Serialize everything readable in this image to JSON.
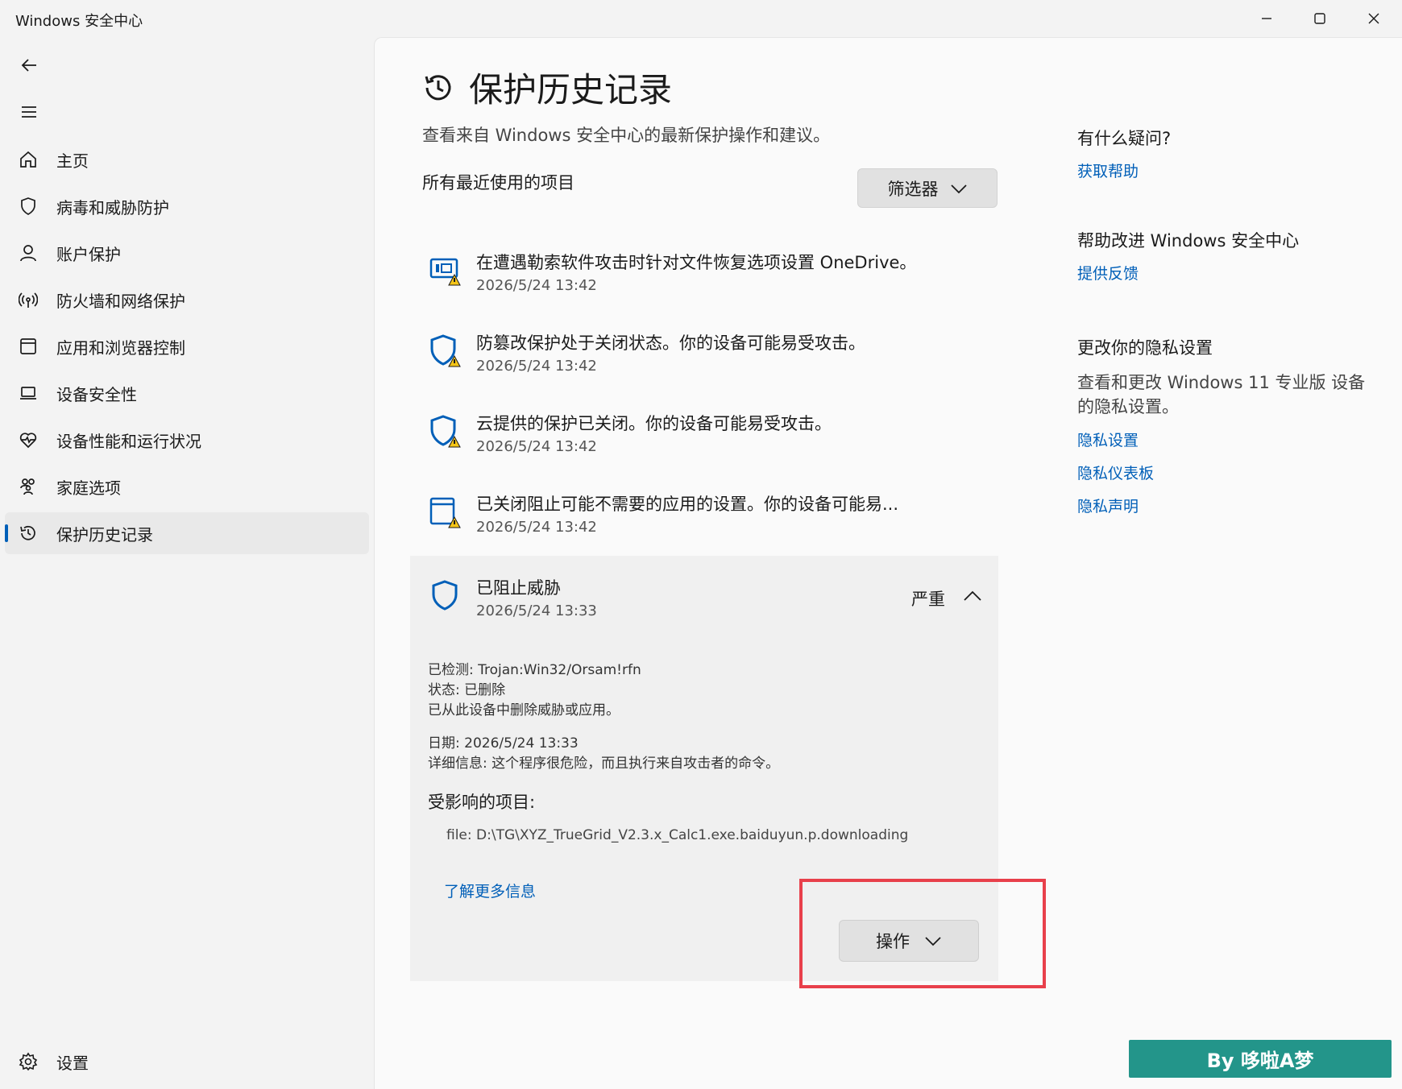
{
  "window": {
    "title": "Windows 安全中心"
  },
  "sidebar": {
    "items": [
      {
        "label": "主页"
      },
      {
        "label": "病毒和威胁防护"
      },
      {
        "label": "账户保护"
      },
      {
        "label": "防火墙和网络保护"
      },
      {
        "label": "应用和浏览器控制"
      },
      {
        "label": "设备安全性"
      },
      {
        "label": "设备性能和运行状况"
      },
      {
        "label": "家庭选项"
      },
      {
        "label": "保护历史记录"
      }
    ],
    "active_index": 8,
    "settings_label": "设置"
  },
  "page": {
    "title": "保护历史记录",
    "subtitle": "查看来自 Windows 安全中心的最新保护操作和建议。",
    "section_label": "所有最近使用的项目",
    "filter_label": "筛选器"
  },
  "history": [
    {
      "title": "在遭遇勒索软件攻击时针对文件恢复选项设置 OneDrive。",
      "time": "2026/5/24 13:42",
      "icon": "ransomware-warning-icon"
    },
    {
      "title": "防篡改保护处于关闭状态。你的设备可能易受攻击。",
      "time": "2026/5/24 13:42",
      "icon": "shield-warning-icon"
    },
    {
      "title": "云提供的保护已关闭。你的设备可能易受攻击。",
      "time": "2026/5/24 13:42",
      "icon": "shield-warning-icon"
    },
    {
      "title": "已关闭阻止可能不需要的应用的设置。你的设备可能易...",
      "time": "2026/5/24 13:42",
      "icon": "app-warning-icon"
    }
  ],
  "expanded": {
    "title": "已阻止威胁",
    "time": "2026/5/24 13:33",
    "severity": "严重",
    "detected": "已检测: Trojan:Win32/Orsam!rfn",
    "status": "状态: 已删除",
    "removed": "已从此设备中删除威胁或应用。",
    "date": "日期: 2026/5/24 13:33",
    "details": "详细信息: 这个程序很危险，而且执行来自攻击者的命令。",
    "affected_title": "受影响的项目:",
    "affected_file": "file: D:\\TG\\XYZ_TrueGrid_V2.3.x_Calc1.exe.baiduyun.p.downloading",
    "learn_more": "了解更多信息",
    "action_label": "操作"
  },
  "right": {
    "question_head": "有什么疑问?",
    "get_help": "获取帮助",
    "improve_head": "帮助改进 Windows 安全中心",
    "feedback": "提供反馈",
    "privacy_head": "更改你的隐私设置",
    "privacy_text": "查看和更改 Windows 11 专业版 设备的隐私设置。",
    "privacy_settings": "隐私设置",
    "privacy_dashboard": "隐私仪表板",
    "privacy_statement": "隐私声明"
  },
  "watermark": "By 哆啦A梦",
  "colors": {
    "accent": "#005fb8",
    "highlight": "#e8404b",
    "badge": "#23958a",
    "warning": "#f5c518"
  }
}
